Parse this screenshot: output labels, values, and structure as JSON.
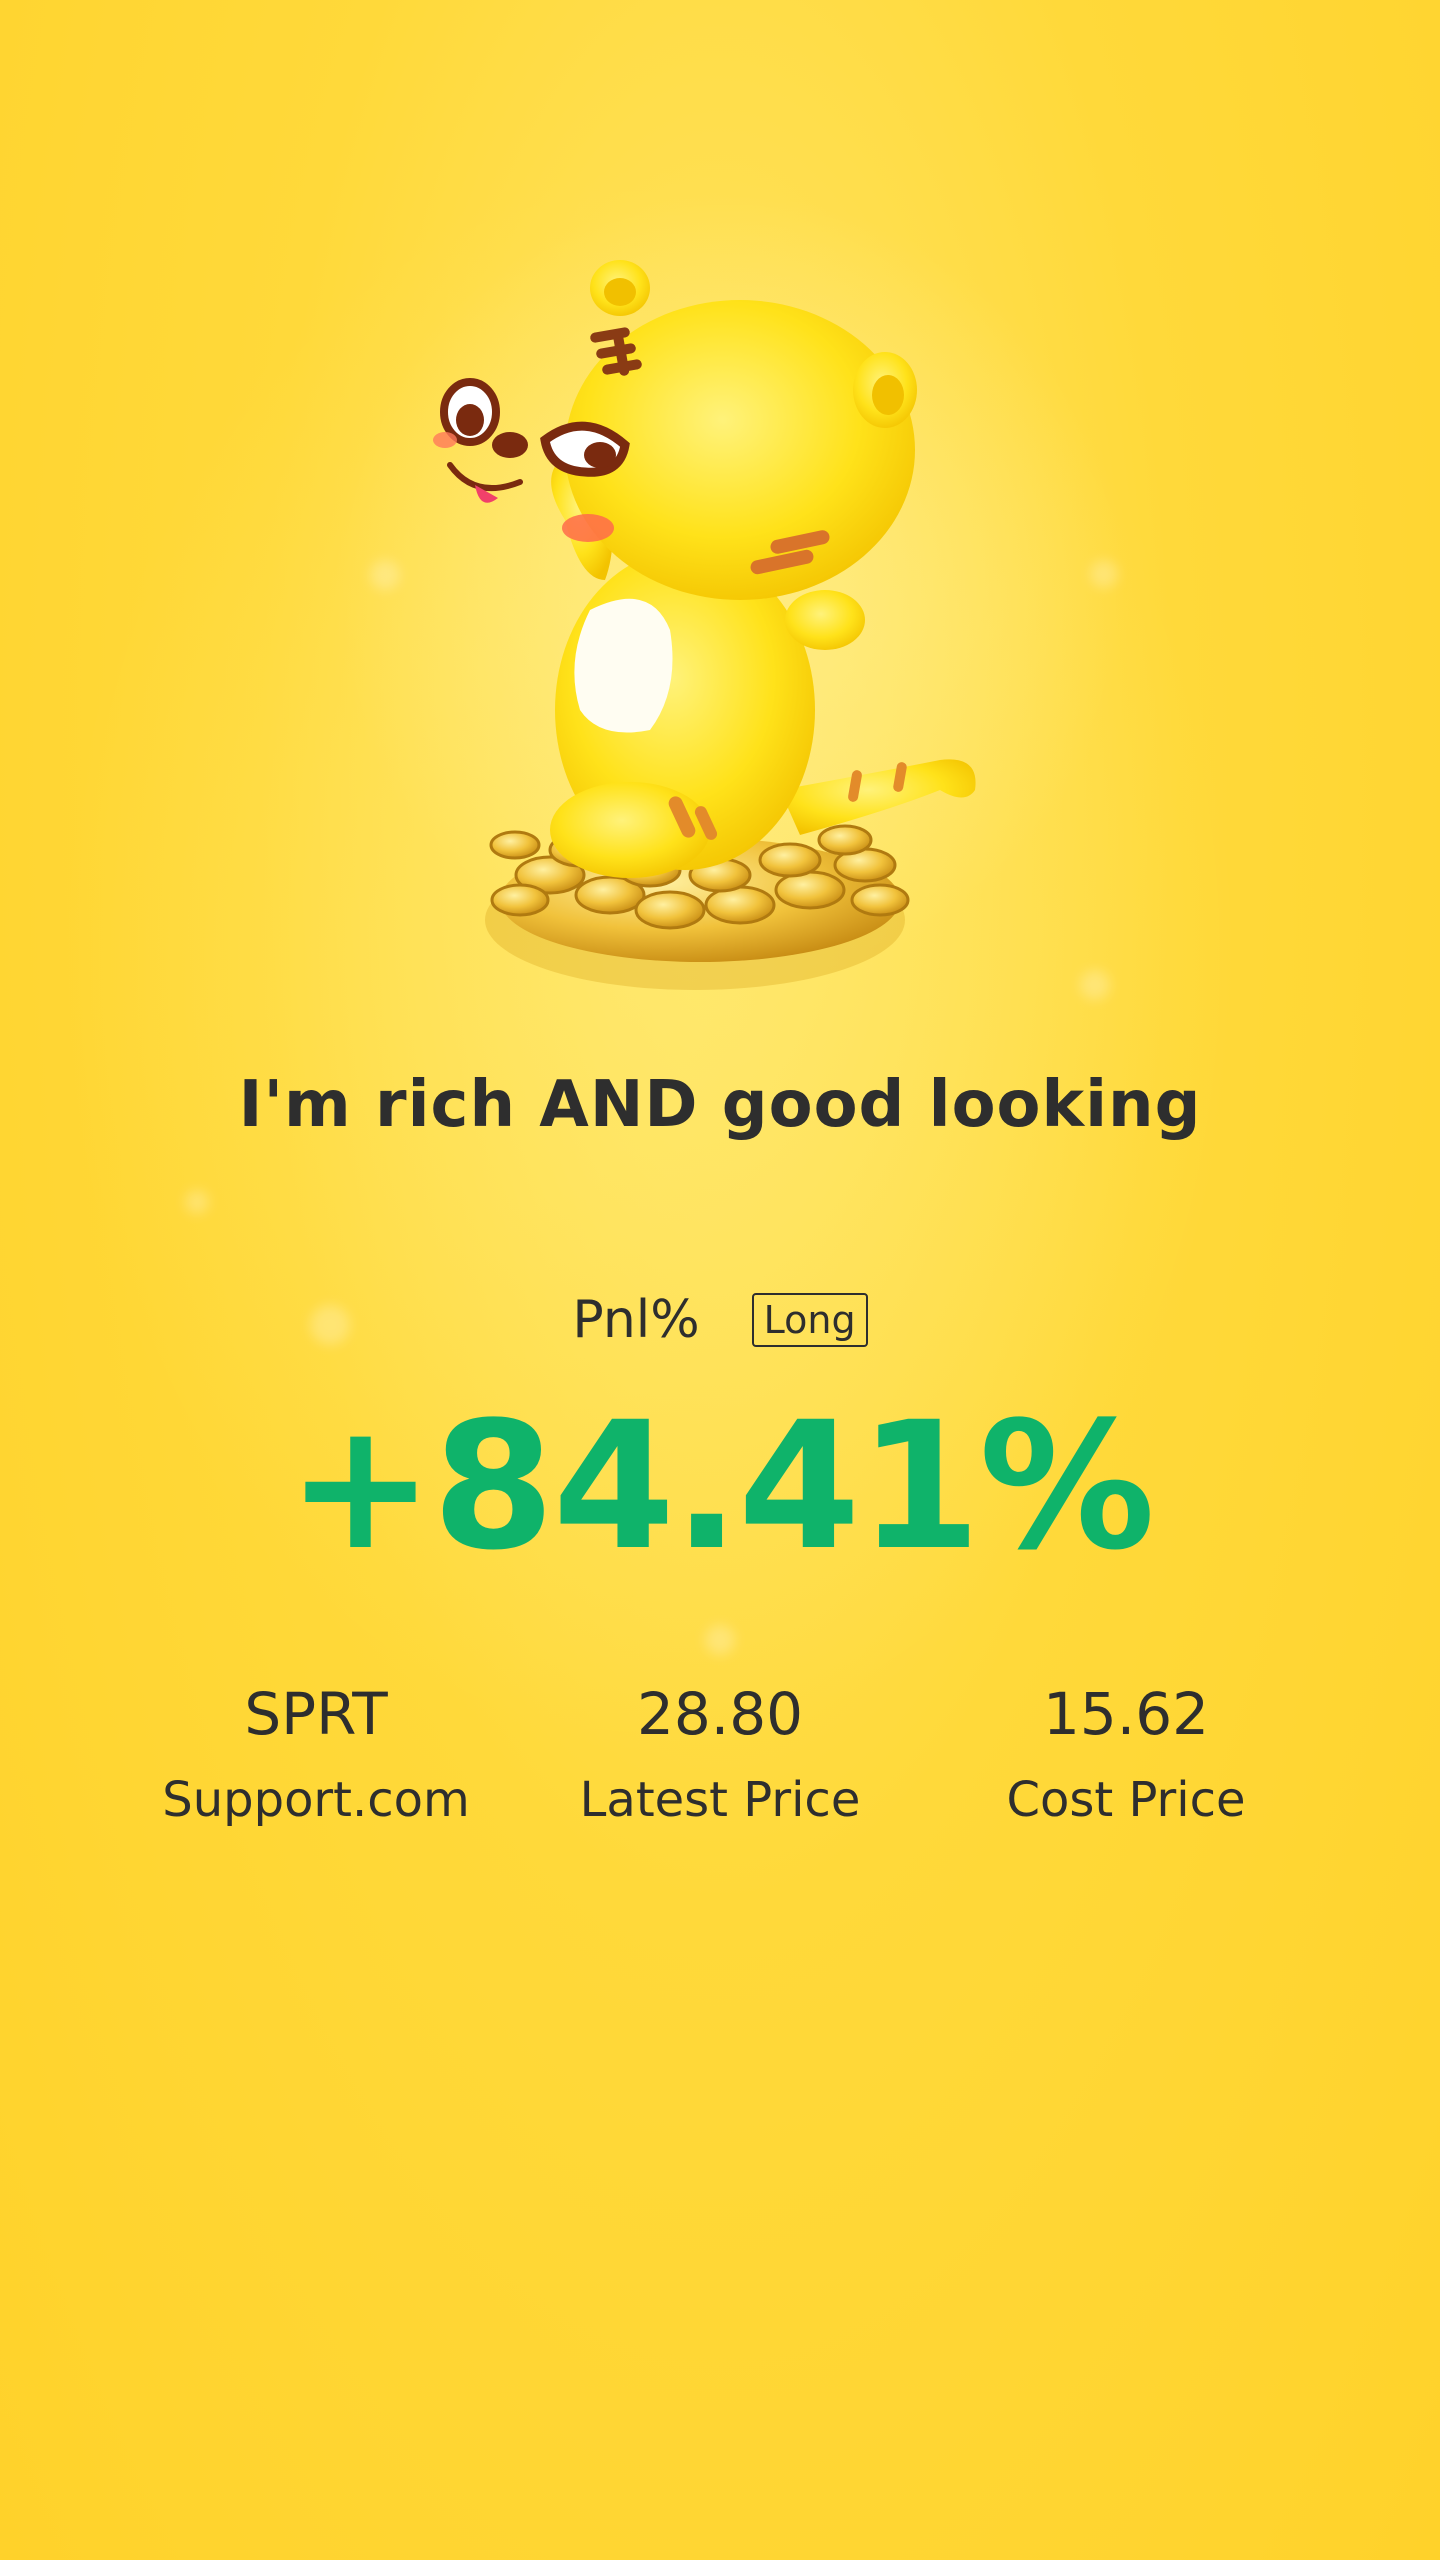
{
  "theme": {
    "background": "#ffd93a",
    "positive_color": "#0fb36a",
    "text_color": "#2e2e2e"
  },
  "hero": {
    "icon": "tiger-mascot-on-coins"
  },
  "tagline": "I'm rich AND good looking",
  "pnl": {
    "label": "Pnl%",
    "direction": "Long",
    "value": "+84.41%"
  },
  "stats": [
    {
      "value": "SPRT",
      "label": "Support.com"
    },
    {
      "value": "28.80",
      "label": "Latest Price"
    },
    {
      "value": "15.62",
      "label": "Cost Price"
    }
  ]
}
